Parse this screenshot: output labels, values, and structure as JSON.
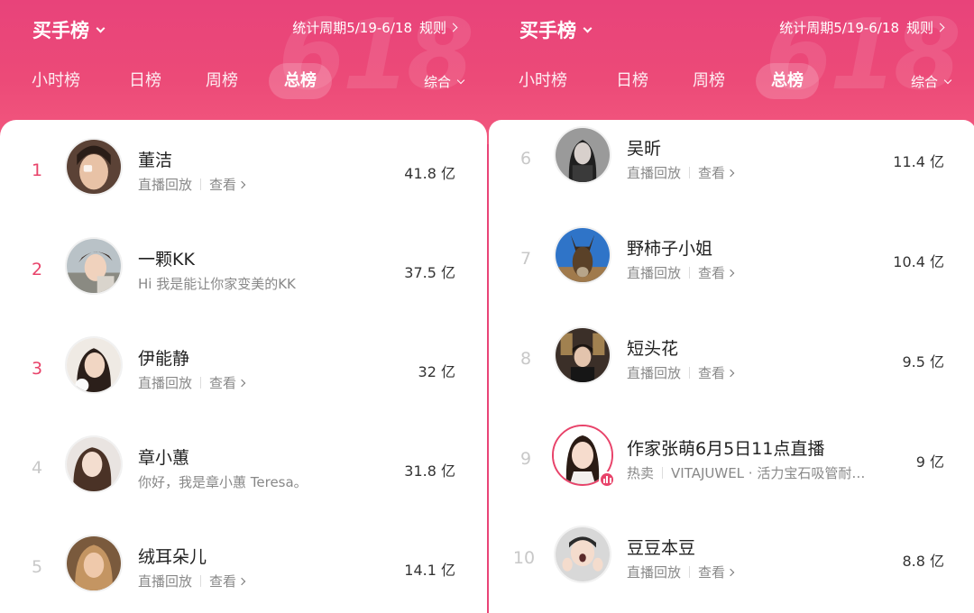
{
  "colors": {
    "accent": "#e94377",
    "rank_top": "#e8436a",
    "text": "#222222",
    "muted": "#888888"
  },
  "left_panel": {
    "title": "买手榜",
    "period": "统计周期5/19-6/18",
    "rules": "规则",
    "watermark": "618",
    "tabs": [
      "小时榜",
      "日榜",
      "周榜",
      "总榜"
    ],
    "active_tab": "总榜",
    "sort": "综合",
    "entries": [
      {
        "rank": "1",
        "name": "董洁",
        "sub_a": "直播回放",
        "sub_b": "查看",
        "value": "41.8 亿",
        "icon": "avatar-icon"
      },
      {
        "rank": "2",
        "name": "一颗KK",
        "tagline": "Hi 我是能让你家变美的KK",
        "value": "37.5 亿",
        "icon": "avatar-icon"
      },
      {
        "rank": "3",
        "name": "伊能静",
        "sub_a": "直播回放",
        "sub_b": "查看",
        "value": "32 亿",
        "icon": "avatar-icon"
      },
      {
        "rank": "4",
        "name": "章小蕙",
        "tagline": "你好，我是章小蕙 Teresa。",
        "value": "31.8 亿",
        "icon": "avatar-icon"
      },
      {
        "rank": "5",
        "name": "绒耳朵儿",
        "sub_a": "直播回放",
        "sub_b": "查看",
        "value": "14.1 亿",
        "icon": "avatar-icon"
      }
    ]
  },
  "right_panel": {
    "title": "买手榜",
    "period": "统计周期5/19-6/18",
    "rules": "规则",
    "watermark": "618",
    "tabs": [
      "小时榜",
      "日榜",
      "周榜",
      "总榜"
    ],
    "active_tab": "总榜",
    "sort": "综合",
    "entries": [
      {
        "rank": "6",
        "name": "吴昕",
        "sub_a": "直播回放",
        "sub_b": "查看",
        "value": "11.4 亿",
        "icon": "avatar-icon"
      },
      {
        "rank": "7",
        "name": "野柿子小姐",
        "sub_a": "直播回放",
        "sub_b": "查看",
        "value": "10.4 亿",
        "icon": "avatar-icon"
      },
      {
        "rank": "8",
        "name": "短头花",
        "sub_a": "直播回放",
        "sub_b": "查看",
        "value": "9.5 亿",
        "icon": "avatar-icon"
      },
      {
        "rank": "9",
        "name": "作家张萌6月5日11点直播",
        "sub_a": "热卖",
        "sub_b": "VITAJUWEL · 活力宝石吸管耐…",
        "value": "9 亿",
        "icon": "avatar-icon",
        "live": true
      },
      {
        "rank": "10",
        "name": "豆豆本豆",
        "sub_a": "直播回放",
        "sub_b": "查看",
        "value": "8.8 亿",
        "icon": "avatar-icon"
      }
    ]
  }
}
